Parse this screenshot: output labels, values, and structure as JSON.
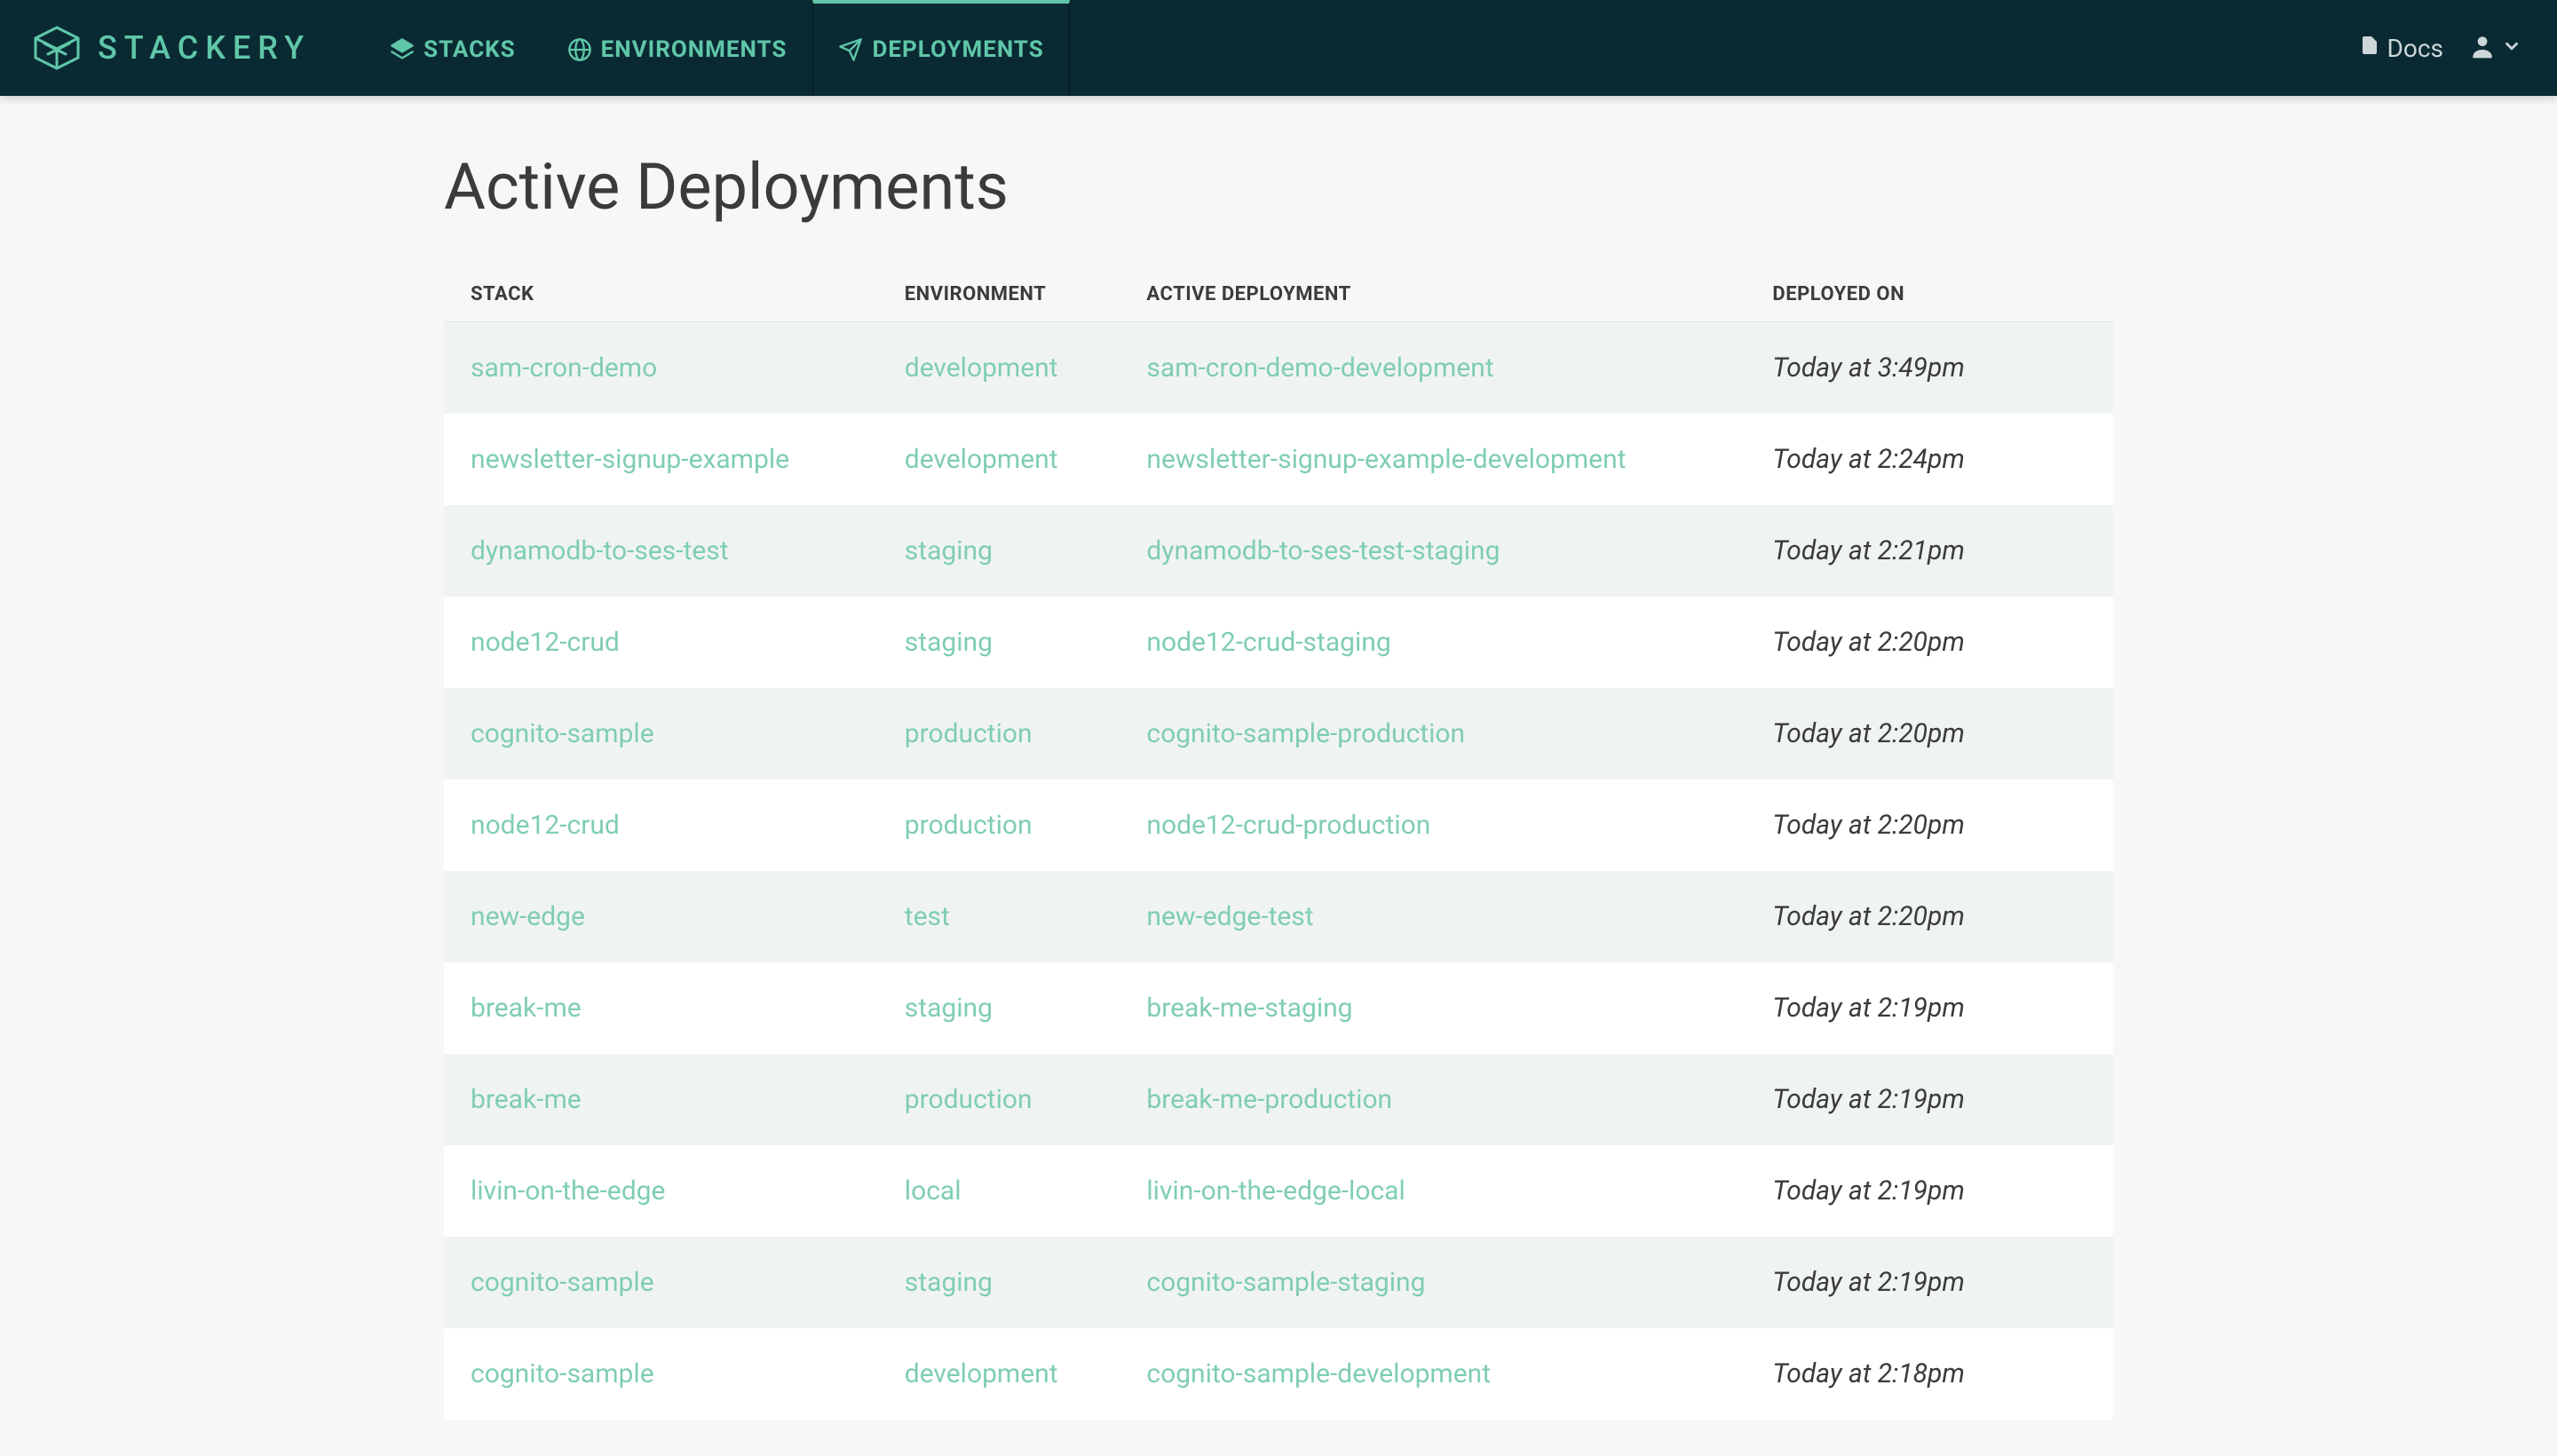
{
  "brand": {
    "name": "STACKERY"
  },
  "nav": {
    "items": [
      {
        "label": "STACKS",
        "icon": "layers-icon",
        "active": false
      },
      {
        "label": "ENVIRONMENTS",
        "icon": "globe-icon",
        "active": false
      },
      {
        "label": "DEPLOYMENTS",
        "icon": "send-icon",
        "active": true
      }
    ]
  },
  "topbar": {
    "docs_label": "Docs"
  },
  "page": {
    "title": "Active Deployments"
  },
  "table": {
    "headers": {
      "stack": "STACK",
      "environment": "ENVIRONMENT",
      "active_deployment": "ACTIVE DEPLOYMENT",
      "deployed_on": "DEPLOYED ON"
    },
    "rows": [
      {
        "stack": "sam-cron-demo",
        "environment": "development",
        "deployment": "sam-cron-demo-development",
        "deployed_on": "Today at 3:49pm"
      },
      {
        "stack": "newsletter-signup-example",
        "environment": "development",
        "deployment": "newsletter-signup-example-development",
        "deployed_on": "Today at 2:24pm"
      },
      {
        "stack": "dynamodb-to-ses-test",
        "environment": "staging",
        "deployment": "dynamodb-to-ses-test-staging",
        "deployed_on": "Today at 2:21pm"
      },
      {
        "stack": "node12-crud",
        "environment": "staging",
        "deployment": "node12-crud-staging",
        "deployed_on": "Today at 2:20pm"
      },
      {
        "stack": "cognito-sample",
        "environment": "production",
        "deployment": "cognito-sample-production",
        "deployed_on": "Today at 2:20pm"
      },
      {
        "stack": "node12-crud",
        "environment": "production",
        "deployment": "node12-crud-production",
        "deployed_on": "Today at 2:20pm"
      },
      {
        "stack": "new-edge",
        "environment": "test",
        "deployment": "new-edge-test",
        "deployed_on": "Today at 2:20pm"
      },
      {
        "stack": "break-me",
        "environment": "staging",
        "deployment": "break-me-staging",
        "deployed_on": "Today at 2:19pm"
      },
      {
        "stack": "break-me",
        "environment": "production",
        "deployment": "break-me-production",
        "deployed_on": "Today at 2:19pm"
      },
      {
        "stack": "livin-on-the-edge",
        "environment": "local",
        "deployment": "livin-on-the-edge-local",
        "deployed_on": "Today at 2:19pm"
      },
      {
        "stack": "cognito-sample",
        "environment": "staging",
        "deployment": "cognito-sample-staging",
        "deployed_on": "Today at 2:19pm"
      },
      {
        "stack": "cognito-sample",
        "environment": "development",
        "deployment": "cognito-sample-development",
        "deployed_on": "Today at 2:18pm"
      }
    ]
  }
}
